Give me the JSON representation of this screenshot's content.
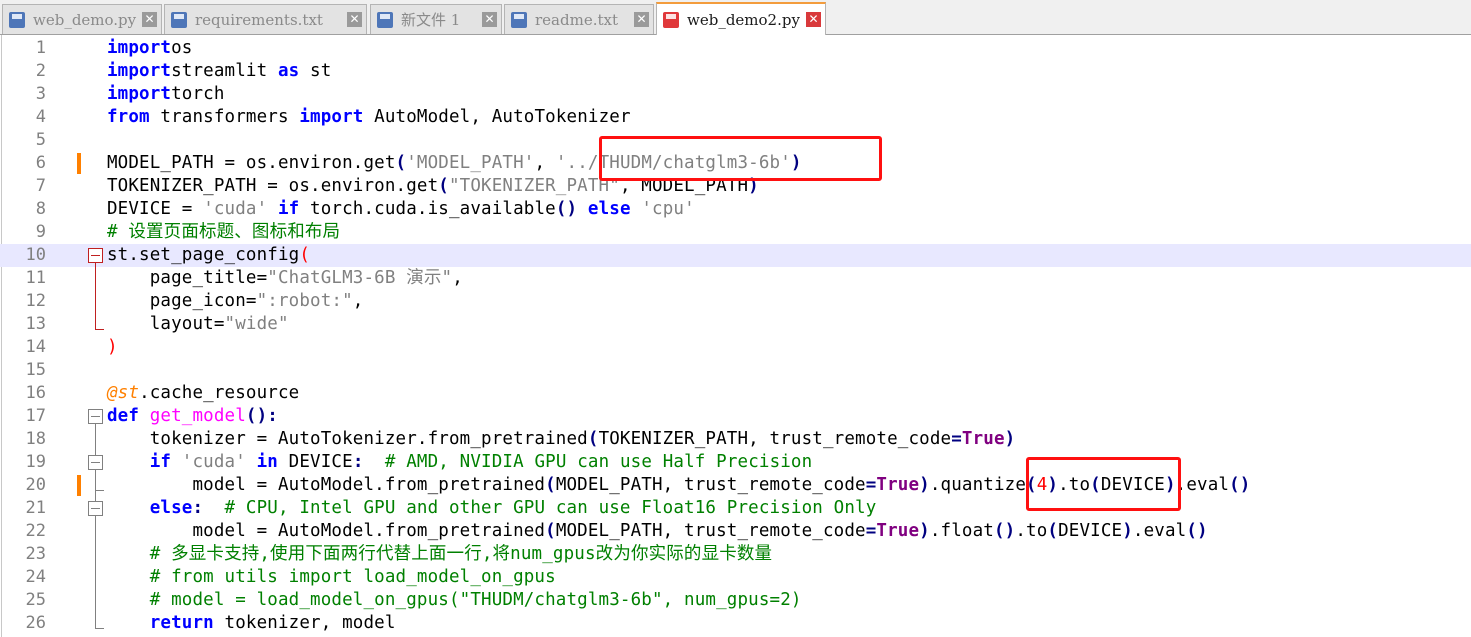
{
  "tabs": [
    {
      "label": "web_demo.py",
      "active": false,
      "close_icon": "close-icon"
    },
    {
      "label": "requirements.txt",
      "active": false,
      "close_icon": "close-icon"
    },
    {
      "label": "新文件 1",
      "active": false,
      "close_icon": "close-icon"
    },
    {
      "label": "readme.txt",
      "active": false,
      "close_icon": "close-icon"
    },
    {
      "label": "web_demo2.py",
      "active": true,
      "close_icon": "close-icon"
    }
  ],
  "lines": [
    {
      "n": "1",
      "tokens": [
        [
          "kw",
          "import"
        ],
        [
          "",
          "os"
        ]
      ]
    },
    {
      "n": "2",
      "tokens": [
        [
          "kw",
          "import"
        ],
        [
          "",
          "streamlit "
        ],
        [
          "kw",
          "as"
        ],
        [
          "",
          " st"
        ]
      ]
    },
    {
      "n": "3",
      "tokens": [
        [
          "kw",
          "import"
        ],
        [
          "",
          "torch"
        ]
      ]
    },
    {
      "n": "4",
      "tokens": [
        [
          "kw",
          "from"
        ],
        [
          "",
          " transformers "
        ],
        [
          "kw",
          "import"
        ],
        [
          "",
          " AutoModel, AutoTokenizer"
        ]
      ]
    },
    {
      "n": "5",
      "tokens": []
    },
    {
      "n": "6",
      "tokens": [
        [
          "",
          "MODEL_PATH = os.environ.get"
        ],
        [
          "op",
          "("
        ],
        [
          "str",
          "'MODEL_PATH'"
        ],
        [
          "",
          ", "
        ],
        [
          "str",
          "'../THUDM/chatglm3-6b'"
        ],
        [
          "op",
          ")"
        ]
      ]
    },
    {
      "n": "7",
      "tokens": [
        [
          "",
          "TOKENIZER_PATH = os.environ.get"
        ],
        [
          "op",
          "("
        ],
        [
          "str",
          "\"TOKENIZER_PATH\""
        ],
        [
          "",
          ", MODEL_PATH"
        ],
        [
          "op",
          ")"
        ]
      ]
    },
    {
      "n": "8",
      "tokens": [
        [
          "",
          "DEVICE = "
        ],
        [
          "str",
          "'cuda'"
        ],
        [
          "kw",
          " if"
        ],
        [
          "",
          " torch.cuda.is_available"
        ],
        [
          "op",
          "()"
        ],
        [
          "kw",
          " else"
        ],
        [
          "str",
          " 'cpu'"
        ]
      ]
    },
    {
      "n": "9",
      "tokens": [
        [
          "cm",
          "# 设置页面标题、图标和布局"
        ]
      ]
    },
    {
      "n": "10",
      "tokens": [
        [
          "",
          "st.set_page_config"
        ],
        [
          "num",
          "("
        ]
      ]
    },
    {
      "n": "11",
      "tokens": [
        [
          "",
          "    page_title="
        ],
        [
          "str",
          "\"ChatGLM3-6B 演示\""
        ],
        [
          "",
          ","
        ]
      ]
    },
    {
      "n": "12",
      "tokens": [
        [
          "",
          "    page_icon="
        ],
        [
          "str",
          "\":robot:\""
        ],
        [
          "",
          ","
        ]
      ]
    },
    {
      "n": "13",
      "tokens": [
        [
          "",
          "    layout="
        ],
        [
          "str",
          "\"wide\""
        ]
      ]
    },
    {
      "n": "14",
      "tokens": [
        [
          "num",
          ")"
        ]
      ]
    },
    {
      "n": "15",
      "tokens": []
    },
    {
      "n": "16",
      "tokens": [
        [
          "dec",
          "@st"
        ],
        [
          "",
          ".cache_resource"
        ]
      ]
    },
    {
      "n": "17",
      "tokens": [
        [
          "kw",
          "def"
        ],
        [
          "fn",
          " get_model"
        ],
        [
          "op",
          "():"
        ]
      ]
    },
    {
      "n": "18",
      "tokens": [
        [
          "",
          "    tokenizer = AutoTokenizer.from_pretrained"
        ],
        [
          "op",
          "("
        ],
        [
          "",
          "TOKENIZER_PATH, trust_remote_code"
        ],
        [
          "op",
          "="
        ],
        [
          "kc",
          "True"
        ],
        [
          "op",
          ")"
        ]
      ]
    },
    {
      "n": "19",
      "tokens": [
        [
          "kw",
          "    if"
        ],
        [
          "str",
          " 'cuda'"
        ],
        [
          "kw",
          " in"
        ],
        [
          "",
          " DEVICE"
        ],
        [
          "op",
          ":"
        ],
        [
          "cm",
          "  # AMD, NVIDIA GPU can use Half Precision"
        ]
      ]
    },
    {
      "n": "20",
      "tokens": [
        [
          "",
          "        model = AutoModel.from_pretrained"
        ],
        [
          "op",
          "("
        ],
        [
          "",
          "MODEL_PATH, trust_remote_code"
        ],
        [
          "op",
          "="
        ],
        [
          "kc",
          "True"
        ],
        [
          "op",
          ")"
        ],
        [
          "",
          ".quantize"
        ],
        [
          "op",
          "("
        ],
        [
          "num",
          "4"
        ],
        [
          "op",
          ")"
        ],
        [
          "",
          ".to"
        ],
        [
          "op",
          "("
        ],
        [
          "",
          "DEVICE"
        ],
        [
          "op",
          ")"
        ],
        [
          "",
          ".eval"
        ],
        [
          "op",
          "()"
        ]
      ]
    },
    {
      "n": "21",
      "tokens": [
        [
          "kw",
          "    else"
        ],
        [
          "op",
          ":"
        ],
        [
          "cm",
          "  # CPU, Intel GPU and other GPU can use Float16 Precision Only"
        ]
      ]
    },
    {
      "n": "22",
      "tokens": [
        [
          "",
          "        model = AutoModel.from_pretrained"
        ],
        [
          "op",
          "("
        ],
        [
          "",
          "MODEL_PATH, trust_remote_code"
        ],
        [
          "op",
          "="
        ],
        [
          "kc",
          "True"
        ],
        [
          "op",
          ")"
        ],
        [
          "",
          ".float"
        ],
        [
          "op",
          "()"
        ],
        [
          "",
          ".to"
        ],
        [
          "op",
          "("
        ],
        [
          "",
          "DEVICE"
        ],
        [
          "op",
          ")"
        ],
        [
          "",
          ".eval"
        ],
        [
          "op",
          "()"
        ]
      ]
    },
    {
      "n": "23",
      "tokens": [
        [
          "cm",
          "    # 多显卡支持,使用下面两行代替上面一行,将num_gpus改为你实际的显卡数量"
        ]
      ]
    },
    {
      "n": "24",
      "tokens": [
        [
          "cm",
          "    # from utils import load_model_on_gpus"
        ]
      ]
    },
    {
      "n": "25",
      "tokens": [
        [
          "cm",
          "    # model = load_model_on_gpus(\"THUDM/chatglm3-6b\", num_gpus=2)"
        ]
      ]
    },
    {
      "n": "26",
      "tokens": [
        [
          "kw",
          "    return"
        ],
        [
          "",
          " tokenizer, model"
        ]
      ]
    }
  ],
  "current_line": "10",
  "changed_lines": [
    "6",
    "20"
  ],
  "annotations": [
    "model-path-highlight",
    "quantize-highlight"
  ],
  "colors": {
    "keyword": "#0000ff",
    "string": "#808080",
    "comment": "#008000",
    "number": "#ff0000",
    "highlight_box": "#ff1010",
    "current_line_bg": "#e8e8ff",
    "change_marker": "#ff8000"
  }
}
